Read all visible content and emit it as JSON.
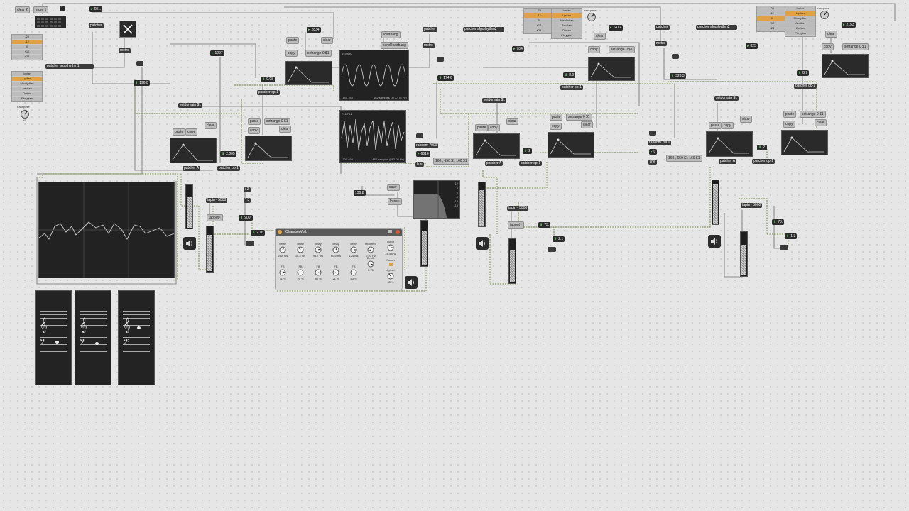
{
  "left_controls": {
    "clear_label": "clear 2",
    "store_label": "store 1",
    "preset_num": "1",
    "transpose_values": [
      "-24",
      "-12",
      "0",
      "+12",
      "+24"
    ],
    "modes": [
      "Ionian",
      "Lydian",
      "Mixolydian",
      "Aeolian",
      "Dorian",
      "Phrygian"
    ],
    "transpose_label": "transpose",
    "transpose_value": "+5"
  },
  "right_menus": {
    "transpose_values": [
      "-24",
      "-12",
      "0",
      "+12",
      "+24"
    ],
    "modes": [
      "Ionian",
      "Lydian",
      "Mixolydian",
      "Aeolian",
      "Dorian",
      "Phrygian"
    ],
    "transpose_label": "transpose",
    "transpose_value": "+5"
  },
  "section1": {
    "num_top": "601.",
    "patcher": "patcher",
    "metro": "metro",
    "algorithm": "patcher algorhythm1",
    "num_1297": "1297",
    "num_2834": "2834",
    "num_196": "196.0",
    "num_908": "9.08",
    "num_2005": "2.005",
    "setdomain": "setdomain $1",
    "setrange": "setrange 0 $1",
    "paste": "paste",
    "copy": "copy",
    "clear": "clear",
    "patcher_op": "patcher op-1",
    "patcher_a": "patcher A",
    "loadbang": "loadbang",
    "send_loadbang": "send loadbang"
  },
  "scope_top": {
    "max": "149.550",
    "min": "-141.765",
    "info": "162 samples (3777.78 Hz)"
  },
  "scope_mid": {
    "max": "716.754",
    "min": "-700.493",
    "info": "487 samples (882.08 Hz)"
  },
  "section2": {
    "patcher": "patcher",
    "metro": "metro",
    "algorithm": "patcher algorhythm2",
    "num_704": "704",
    "num_1472": "1472",
    "num_1746": "174.6",
    "num_89": "8.9",
    "num_2": "2",
    "random": "random 7000",
    "num_6616": "6616",
    "line": "line",
    "line_msg": "160., 650 $1 160 $1",
    "patcher_a": "patcher A",
    "patcher_op": "patcher op-1",
    "setdomain": "setdomain $1",
    "setrange": "setrange 0 $1",
    "tapin": "tapin~ 5000",
    "tapout": "tapout~",
    "num_21": "2.1",
    "num_73": "73."
  },
  "section3": {
    "patcher": "patcher",
    "metro": "metro",
    "algorithm": "patcher algorhythm2",
    "num_825": "825",
    "num_2153": "2153",
    "num_5233": "523.3",
    "num_89": "8.9",
    "num_2": "2.",
    "random": "random 7000",
    "num_0": "0",
    "line": "line",
    "line_msg": "160., 650 $1 160 $1",
    "patcher_a": "patcher A",
    "patcher_op": "patcher op-1",
    "setdomain": "setdomain $1",
    "setrange": "setrange 0 $1",
    "tapin": "tapin~ 5000",
    "num_73": "73.",
    "num_13": "1.3"
  },
  "mid_objects": {
    "tapin": "tapin~ 5000",
    "tapout": "tapout~",
    "div2": "/ 2",
    "mul3": "* 3",
    "num_900": "900.",
    "num_216": "2.16",
    "num_1308": "130.8",
    "saw": "saw~",
    "lores": "lores~",
    "meter_scale": [
      "12",
      "6",
      "0",
      "-6",
      "-12",
      "-18"
    ]
  },
  "chamberverb": {
    "title": "ChamberVerb",
    "params": [
      {
        "label": "delay",
        "value": "19.8 ms"
      },
      {
        "label": "delay",
        "value": "18.3 ms"
      },
      {
        "label": "delay",
        "value": "94.7 ms"
      },
      {
        "label": "delay",
        "value": "60.5 ms"
      },
      {
        "label": "delay",
        "value": "124 ms"
      },
      {
        "label": "FB",
        "value": "71 %"
      },
      {
        "label": "FB",
        "value": "25 %"
      },
      {
        "label": "FB",
        "value": "80 %"
      },
      {
        "label": "FB",
        "value": "21 %"
      },
      {
        "label": "FB",
        "value": "83 %"
      }
    ],
    "modfreq_label": "Mod freq",
    "modfreq_value": "0.20 Hz",
    "depth_label": "Depth",
    "depth_value": "0.75",
    "cutoff_label": "cutoff",
    "cutoff_value": "14.4 kHz",
    "punch_label": "Punch",
    "drywet_label": "dry/wet",
    "drywet_value": "40 %"
  }
}
